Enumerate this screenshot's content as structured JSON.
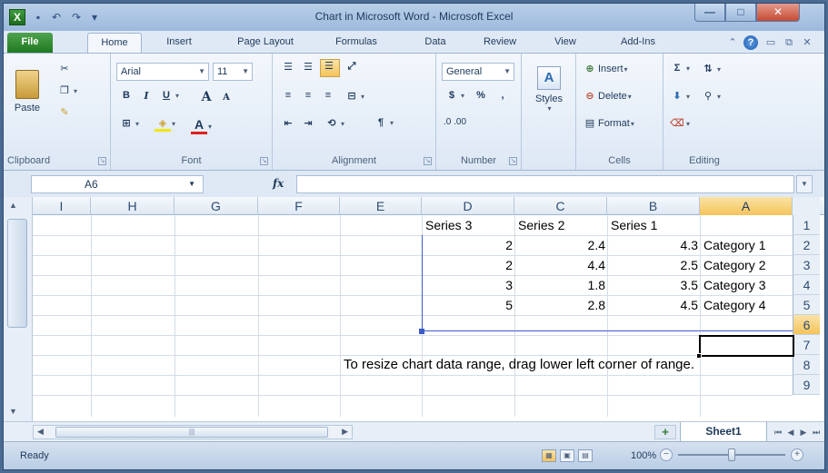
{
  "window": {
    "title": "Chart in Microsoft Word - Microsoft Excel",
    "app_logo": "X"
  },
  "icons": {
    "app": "excel-logo-icon",
    "save": "save-icon",
    "undo": "undo-icon",
    "redo": "redo-icon",
    "help": "help-icon"
  },
  "colors": {
    "file_tab": "#1f7a1f",
    "selection_highlight": "#f4c45a",
    "range_border": "#3b5cc6",
    "close_button": "#c64a34"
  },
  "ribbon": {
    "file_tab": "File",
    "tabs": [
      "Home",
      "Insert",
      "Page Layout",
      "Formulas",
      "Data",
      "Review",
      "View",
      "Add-Ins"
    ],
    "active_tab": "Home",
    "groups": {
      "clipboard": {
        "label": "Clipboard",
        "paste": "Paste"
      },
      "font": {
        "label": "Font",
        "font_name": "Arial",
        "font_size": "11",
        "bold": "B",
        "italic": "I",
        "underline": "U",
        "grow": "A",
        "shrink": "A",
        "color": "A"
      },
      "alignment": {
        "label": "Alignment"
      },
      "number": {
        "label": "Number",
        "format": "General",
        "currency": "$",
        "percent": "%",
        "comma": ",",
        "inc_dec": ".0 .00"
      },
      "styles": {
        "label": "",
        "button": "Styles"
      },
      "cells": {
        "label": "Cells",
        "insert": "Insert",
        "delete": "Delete",
        "format": "Format"
      },
      "editing": {
        "label": "Editing",
        "sum": "Σ"
      }
    }
  },
  "formula_bar": {
    "name_box": "A6",
    "fx": "fx",
    "formula": ""
  },
  "grid": {
    "columns": [
      "I",
      "H",
      "G",
      "F",
      "E",
      "D",
      "C",
      "B",
      "A"
    ],
    "selected_column": "A",
    "rows": [
      "1",
      "2",
      "3",
      "4",
      "5",
      "6",
      "7",
      "8",
      "9"
    ],
    "selected_row": "6",
    "headers": {
      "series3": "Series 3",
      "series2": "Series 2",
      "series1": "Series 1"
    },
    "data": [
      {
        "category": "Category 1",
        "series1": "4.3",
        "series2": "2.4",
        "series3": "2"
      },
      {
        "category": "Category 2",
        "series1": "2.5",
        "series2": "4.4",
        "series3": "2"
      },
      {
        "category": "Category 3",
        "series1": "3.5",
        "series2": "1.8",
        "series3": "3"
      },
      {
        "category": "Category 4",
        "series1": "4.5",
        "series2": "2.8",
        "series3": "5"
      }
    ],
    "note": "To resize chart data range, drag lower left corner of range."
  },
  "sheet_tabs": {
    "active": "Sheet1"
  },
  "status_bar": {
    "status": "Ready",
    "zoom": "100%",
    "zoom_fraction": 0.5
  }
}
